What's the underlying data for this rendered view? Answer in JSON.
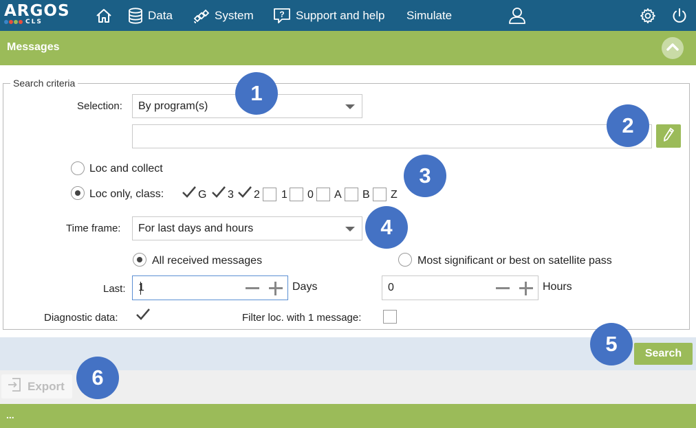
{
  "app": {
    "logo_main": "ARGOS",
    "logo_sub": "CLS",
    "logo_dot_colors": [
      "#3a86c8",
      "#e94f3c",
      "#9bbb59",
      "#e94f3c"
    ]
  },
  "nav": {
    "home_icon": "home-icon",
    "data": "Data",
    "system": "System",
    "support": "Support and help",
    "simulate": "Simulate",
    "user_icon": "user-icon",
    "settings_icon": "gear-icon",
    "power_icon": "power-icon"
  },
  "page": {
    "title": "Messages"
  },
  "search_criteria": {
    "legend": "Search criteria",
    "selection_label": "Selection:",
    "selection_value": "By program(s)",
    "program_input_value": "",
    "loc_collect_label": "Loc and collect",
    "loc_only_label": "Loc only, class:",
    "loc_mode_selected": "loc_only",
    "classes": [
      {
        "label": "G",
        "checked": true
      },
      {
        "label": "3",
        "checked": true
      },
      {
        "label": "2",
        "checked": true
      },
      {
        "label": "1",
        "checked": false
      },
      {
        "label": "0",
        "checked": false
      },
      {
        "label": "A",
        "checked": false
      },
      {
        "label": "B",
        "checked": false
      },
      {
        "label": "Z",
        "checked": false
      }
    ],
    "timeframe_label": "Time frame:",
    "timeframe_value": "For last days and hours",
    "all_received_label": "All received messages",
    "most_significant_label": "Most significant or best on satellite pass",
    "message_mode_selected": "all_received",
    "last_label": "Last:",
    "days_value": "1",
    "days_label": "Days",
    "hours_value": "0",
    "hours_label": "Hours",
    "diagnostic_label": "Diagnostic data:",
    "diagnostic_checked": true,
    "filter_label": "Filter loc. with 1 message:",
    "filter_checked": false
  },
  "actions": {
    "search": "Search",
    "export": "Export"
  },
  "footer": {
    "text": "..."
  },
  "callouts": [
    "1",
    "2",
    "3",
    "4",
    "5",
    "6"
  ],
  "colors": {
    "nav_bg": "#1b5f86",
    "accent_green": "#9bbb59",
    "callout_blue": "#4472c4",
    "action_bar": "#dee7f1"
  }
}
